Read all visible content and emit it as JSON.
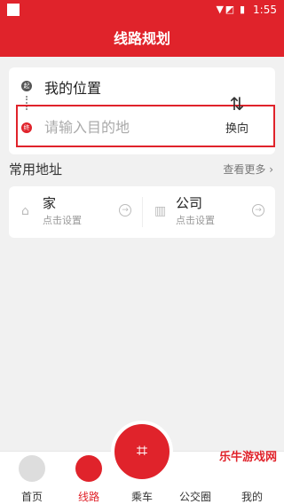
{
  "status": {
    "time": "1:55"
  },
  "appbar": {
    "title": "线路规划"
  },
  "route": {
    "start_badge": "起",
    "start_label": "我的位置",
    "end_badge": "终",
    "destination_placeholder": "请输入目的地",
    "swap_label": "换向"
  },
  "favorites": {
    "title": "常用地址",
    "more_label": "查看更多",
    "items": [
      {
        "name": "家",
        "sub": "点击设置"
      },
      {
        "name": "公司",
        "sub": "点击设置"
      }
    ]
  },
  "tabs": [
    {
      "label": "首页"
    },
    {
      "label": "线路"
    },
    {
      "label": "乘车"
    },
    {
      "label": "公交圈"
    },
    {
      "label": "我的"
    }
  ],
  "watermark": {
    "text": "乐牛游戏网"
  },
  "colors": {
    "brand": "#e0232b",
    "background": "#f1f1f1"
  }
}
